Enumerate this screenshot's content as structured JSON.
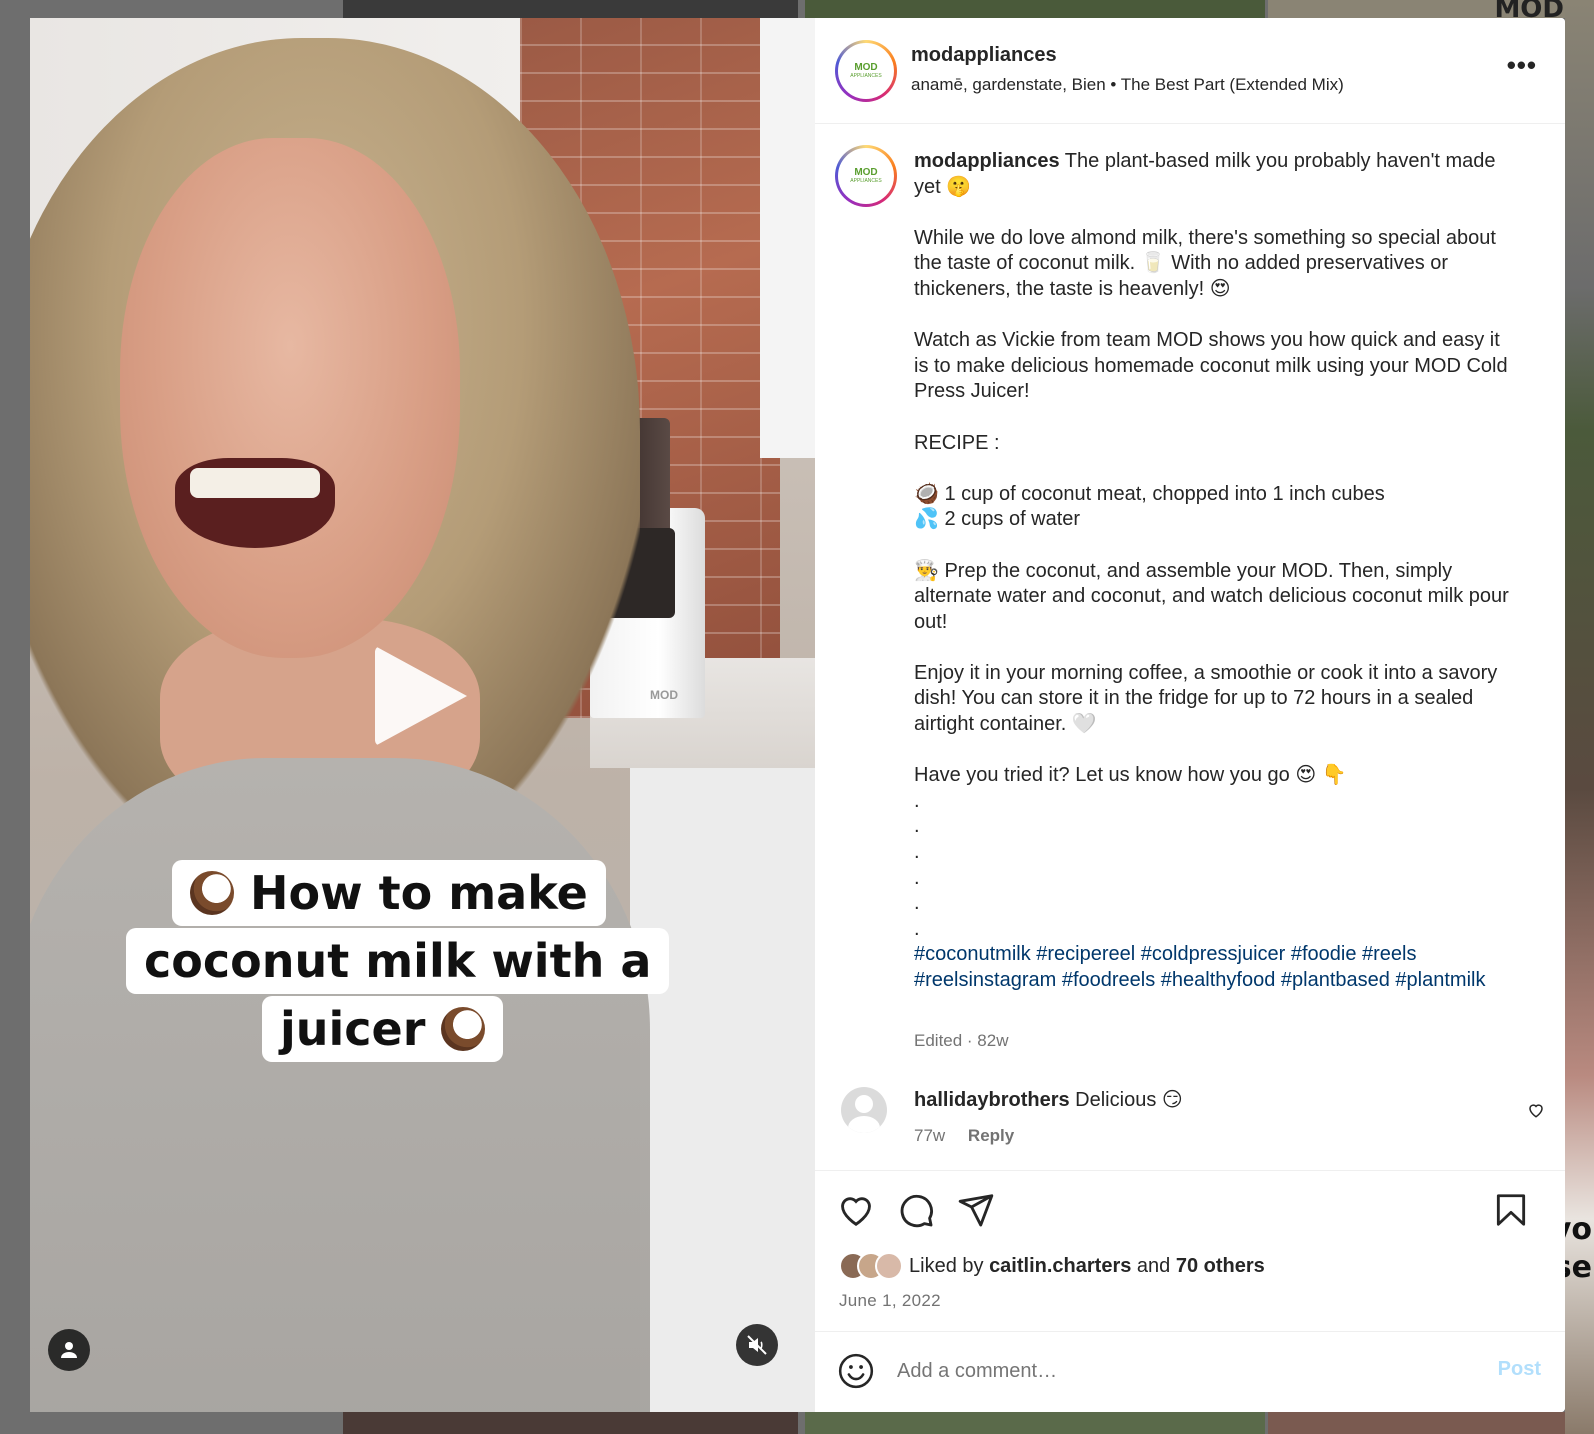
{
  "background": {
    "corner_text": "MOD",
    "side_text_1": "yo",
    "side_text_2": "se"
  },
  "post": {
    "username": "modappliances",
    "avatar_logo_top": "MOD",
    "avatar_logo_bottom": "APPLIANCES",
    "audio": "anamē, gardenstate, Bien • The Best Part (Extended Mix)",
    "more_icon": "more-horizontal-icon"
  },
  "video": {
    "caption_line_1": "How to make",
    "caption_line_2": "coconut milk with a",
    "caption_line_3": "juicer",
    "play_icon": "play-icon",
    "user_icon": "user-icon",
    "mute_icon": "muted-speaker-icon",
    "juicer_brand": "MOD"
  },
  "caption": {
    "author": "modappliances",
    "text": " The plant-based milk you probably haven't made yet 🤫\n\nWhile we do love almond milk, there's something so special about the taste of coconut milk. 🥛 With no added preservatives or thickeners, the taste is heavenly! 😍\n\nWatch as Vickie from team MOD shows you how quick and easy it is to make delicious homemade coconut milk using your MOD Cold Press Juicer!\n\nRECIPE :\n\n🥥 1 cup of coconut meat, chopped into 1 inch cubes\n💦 2 cups of water\n\n👨‍🍳 Prep the coconut, and assemble your MOD. Then, simply alternate water and coconut, and watch delicious coconut milk pour out!\n\nEnjoy it in your morning coffee, a smoothie or cook it into a savory dish! You can store it in the fridge for up to 72 hours in a sealed airtight container. 🤍\n\nHave you tried it? Let us know how you go 😍 👇\n.\n.\n.\n.\n.\n.",
    "hashtags": "#coconutmilk #recipereel #coldpressjuicer #foodie #reels #reelsinstagram #foodreels #healthyfood #plantbased #plantmilk",
    "edited": "Edited · 82w"
  },
  "comments": [
    {
      "user": "hallidaybrothers",
      "text": "Delicious 😏",
      "time": "77w",
      "reply_label": "Reply"
    }
  ],
  "actions": {
    "like_icon": "heart-icon",
    "comment_icon": "comment-icon",
    "share_icon": "send-icon",
    "save_icon": "bookmark-icon",
    "liked_prefix": "Liked by",
    "liked_user": "caitlin.charters",
    "liked_and": "and",
    "liked_others": "70 others",
    "date": "June 1, 2022"
  },
  "add_comment": {
    "placeholder": "Add a comment…",
    "post_label": "Post",
    "emoji_icon": "emoji-icon"
  },
  "colors": {
    "link": "#00376b",
    "muted": "#737373",
    "post_disabled": "#b2dffc",
    "brand_green": "#5a9e2f"
  }
}
